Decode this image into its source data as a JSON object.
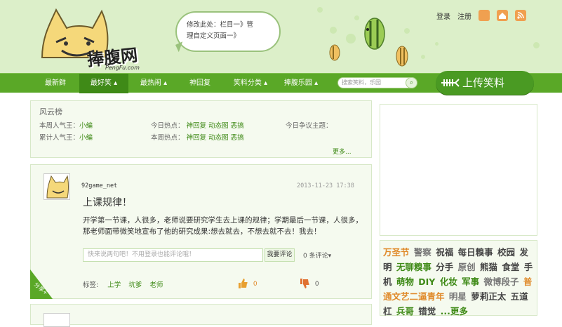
{
  "header": {
    "logo_text": "捧腹网",
    "logo_sub": "PengFu.com",
    "bubble_line1": "修改此处：栏目一》管",
    "bubble_line2": "理自定义页面一》"
  },
  "toplinks": {
    "login": "登录",
    "register": "注册"
  },
  "nav": {
    "items": [
      "最新鲜",
      "最好笑",
      "最热闹",
      "神回复",
      "笑料分类",
      "捧腹乐园"
    ],
    "active_index": 1,
    "search_placeholder": "搜索笑料，乐园",
    "upload_label": "上传笑料"
  },
  "rank": {
    "title": "风云榜",
    "week_king_label": "本周人气王：",
    "week_king": "小编",
    "total_king_label": "累计人气王：",
    "total_king": "小编",
    "today_hot_label": "今日热点：",
    "week_hot_label": "本周热点：",
    "hot_items": [
      "神回复",
      "动态图",
      "恶搞"
    ],
    "today_debate_label": "今日争议主题：",
    "more": "更多..."
  },
  "post": {
    "username": "92game_net",
    "time": "2013-11-23 17:38",
    "title": "上课规律！",
    "body": "开学第一节课，人很多，老师说要研究学生去上课的规律；学期最后一节课，人很多，那老师面带微笑地宣布了他的研究成果:想去就去，不想去就不去！我去！",
    "comment_placeholder": "快来说两句吧！不用登录也能评论哦！",
    "comment_button": "我要评论",
    "comment_count": "0 条评论",
    "comment_count_suffix": "▾",
    "share_label": "分享+",
    "tags_label": "标签:",
    "tags": [
      "上学",
      "坑爹",
      "老师"
    ],
    "up_count": "0",
    "down_count": "0"
  },
  "tagcloud": [
    {
      "text": "万圣节",
      "tone": "o"
    },
    {
      "text": "警察",
      "tone": "gy"
    },
    {
      "text": "祝福",
      "tone": "dk"
    },
    {
      "text": "每日糗事",
      "tone": "dk"
    },
    {
      "text": "校园",
      "tone": "dk"
    },
    {
      "text": "发明",
      "tone": "dk"
    },
    {
      "text": "无聊糗事",
      "tone": "gr"
    },
    {
      "text": "分手",
      "tone": "dk"
    },
    {
      "text": "原创",
      "tone": "gy"
    },
    {
      "text": "熊猫",
      "tone": "dk"
    },
    {
      "text": "食堂",
      "tone": "dk"
    },
    {
      "text": "手机",
      "tone": "dk"
    },
    {
      "text": "萌物",
      "tone": "gr"
    },
    {
      "text": "DIY",
      "tone": "gr"
    },
    {
      "text": "化妆",
      "tone": "gr"
    },
    {
      "text": "军事",
      "tone": "gr"
    },
    {
      "text": "微博段子",
      "tone": "gy"
    },
    {
      "text": "普通文艺二逼青年",
      "tone": "o"
    },
    {
      "text": "明星",
      "tone": "gy"
    },
    {
      "text": "萝莉正太",
      "tone": "dk"
    },
    {
      "text": "五道杠",
      "tone": "dk"
    },
    {
      "text": "兵哥",
      "tone": "gr"
    },
    {
      "text": "错觉",
      "tone": "dk"
    },
    {
      "text": "...更多",
      "tone": "gr"
    }
  ],
  "colors": {
    "brand_green": "#5aa827",
    "active_nav": "#3f8a17",
    "accent_orange": "#e08a2a"
  }
}
